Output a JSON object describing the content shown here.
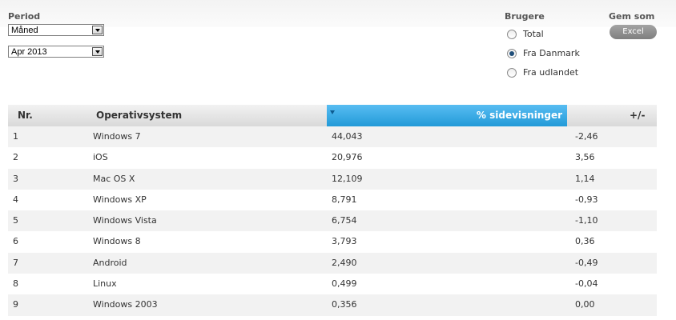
{
  "period": {
    "label": "Period",
    "granularity": "Måned",
    "month": "Apr 2013"
  },
  "users": {
    "label": "Brugere",
    "options": [
      {
        "label": "Total",
        "checked": false
      },
      {
        "label": "Fra Danmark",
        "checked": true
      },
      {
        "label": "Fra udlandet",
        "checked": false
      }
    ]
  },
  "export": {
    "label": "Gem som",
    "button": "Excel"
  },
  "table": {
    "headers": {
      "nr": "Nr.",
      "os": "Operativsystem",
      "pct": "% sidevisninger",
      "change": "+/-"
    },
    "sort_icon": "sort-desc-icon",
    "rows": [
      {
        "nr": "1",
        "os": "Windows 7",
        "pct": "44,043",
        "change": "-2,46"
      },
      {
        "nr": "2",
        "os": "iOS",
        "pct": "20,976",
        "change": "3,56"
      },
      {
        "nr": "3",
        "os": "Mac OS X",
        "pct": "12,109",
        "change": "1,14"
      },
      {
        "nr": "4",
        "os": "Windows XP",
        "pct": "8,791",
        "change": "-0,93"
      },
      {
        "nr": "5",
        "os": "Windows Vista",
        "pct": "6,754",
        "change": "-1,10"
      },
      {
        "nr": "6",
        "os": "Windows 8",
        "pct": "3,793",
        "change": "0,36"
      },
      {
        "nr": "7",
        "os": "Android",
        "pct": "2,490",
        "change": "-0,49"
      },
      {
        "nr": "8",
        "os": "Linux",
        "pct": "0,499",
        "change": "-0,04"
      },
      {
        "nr": "9",
        "os": "Windows 2003",
        "pct": "0,356",
        "change": "0,00"
      }
    ]
  },
  "colors": {
    "sorted_header": "#229ad8",
    "header_gray": "#d9d9d9",
    "row_stripe": "#f2f2f2"
  }
}
